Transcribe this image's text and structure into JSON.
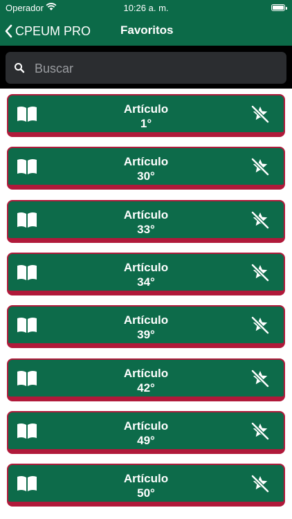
{
  "status_bar": {
    "carrier": "Operador",
    "time": "10:26 a. m."
  },
  "nav": {
    "back_label": "CPEUM PRO",
    "title": "Favoritos"
  },
  "search": {
    "placeholder": "Buscar"
  },
  "favorites": [
    {
      "label": "Artículo",
      "number": "1°"
    },
    {
      "label": "Artículo",
      "number": "30°"
    },
    {
      "label": "Artículo",
      "number": "33°"
    },
    {
      "label": "Artículo",
      "number": "34°"
    },
    {
      "label": "Artículo",
      "number": "39°"
    },
    {
      "label": "Artículo",
      "number": "42°"
    },
    {
      "label": "Artículo",
      "number": "49°"
    },
    {
      "label": "Artículo",
      "number": "50°"
    }
  ],
  "icons": {
    "back": "chevron-left-icon",
    "search": "search-icon",
    "item_leading": "book-icon",
    "item_trailing": "star-slash-icon"
  },
  "colors": {
    "primary": "#0c6a48",
    "item_border": "#b0193a",
    "search_background": "#2b2d30"
  }
}
